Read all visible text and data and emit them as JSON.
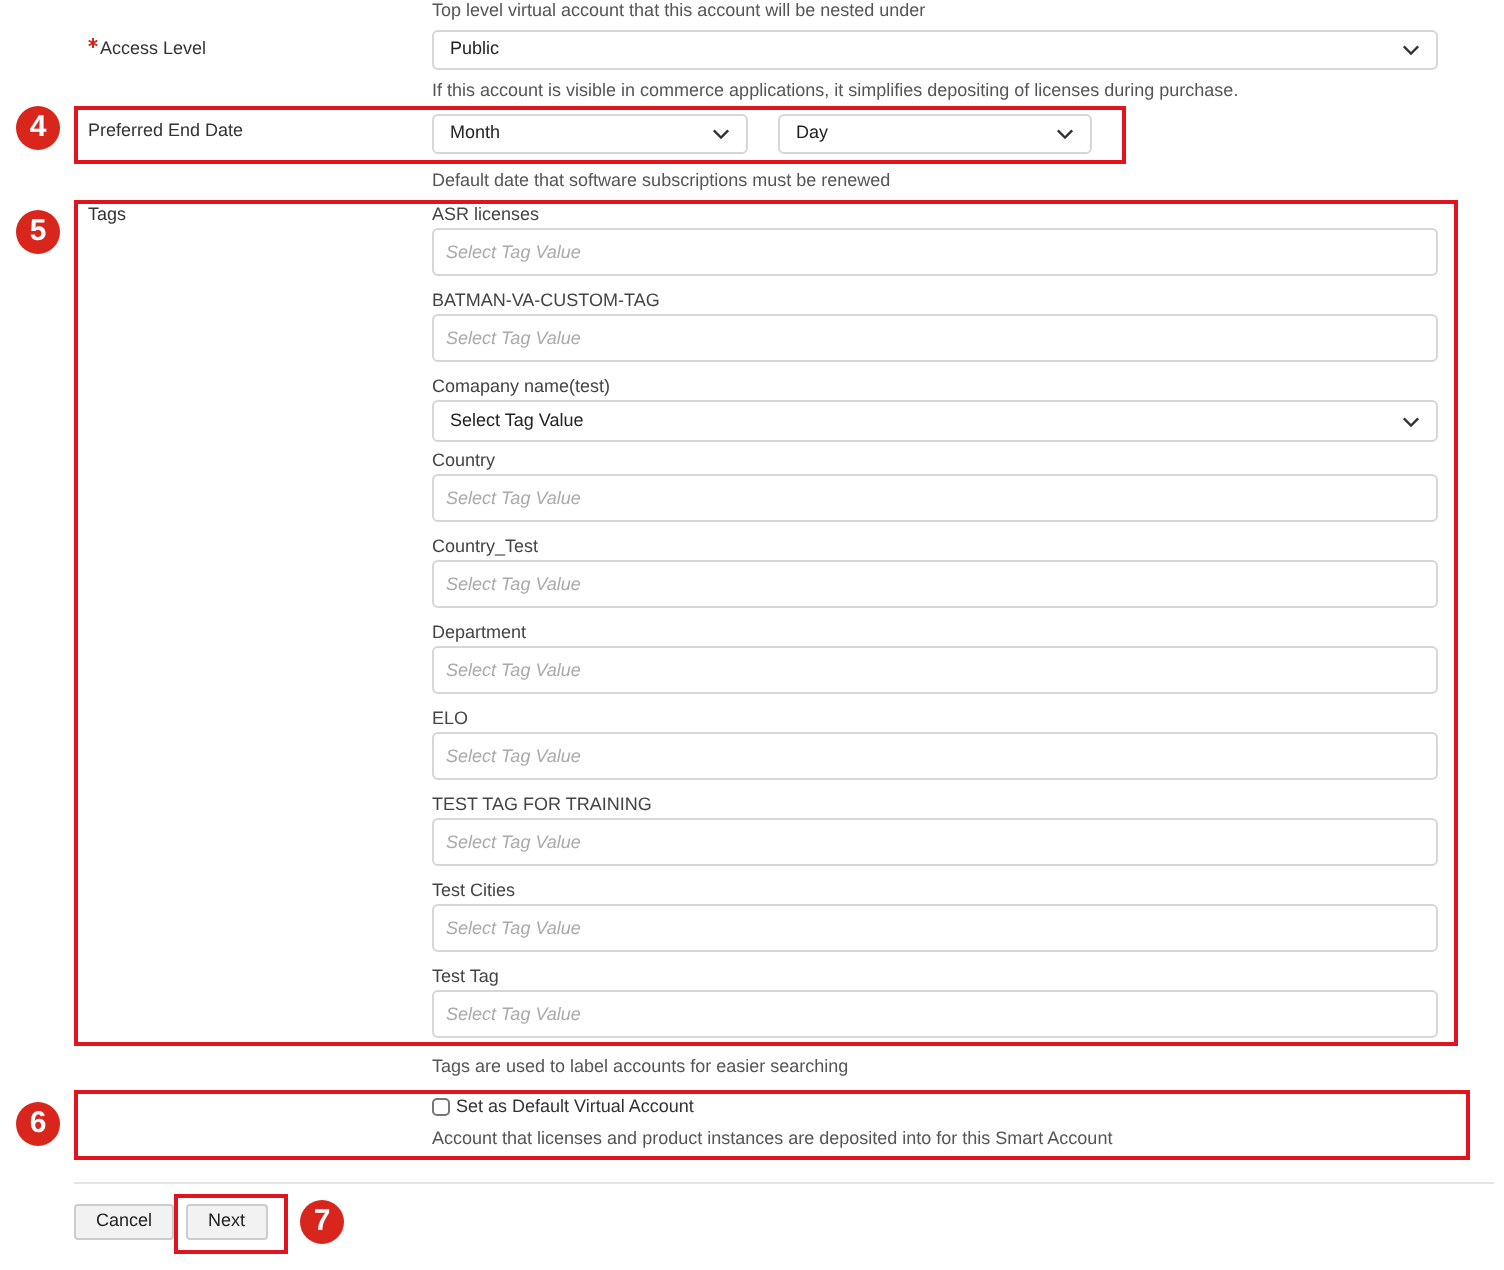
{
  "parent_help": "Top level virtual account that this account will be nested under",
  "access_level": {
    "label": "Access Level",
    "required": true,
    "value": "Public",
    "help": "If this account is visible in commerce applications, it simplifies depositing of licenses during purchase."
  },
  "preferred_end_date": {
    "label": "Preferred End Date",
    "month": "Month",
    "day": "Day",
    "help": "Default date that software subscriptions must be renewed",
    "callout": "4"
  },
  "tags": {
    "label": "Tags",
    "callout": "5",
    "items": [
      {
        "name": "ASR licenses",
        "kind": "text",
        "placeholder": "Select Tag Value"
      },
      {
        "name": "BATMAN-VA-CUSTOM-TAG",
        "kind": "text",
        "placeholder": "Select Tag Value"
      },
      {
        "name": "Comapany name(test)",
        "kind": "select",
        "value": "Select Tag Value"
      },
      {
        "name": "Country",
        "kind": "text",
        "placeholder": "Select Tag Value"
      },
      {
        "name": "Country_Test",
        "kind": "text",
        "placeholder": "Select Tag Value"
      },
      {
        "name": "Department",
        "kind": "text",
        "placeholder": "Select Tag Value"
      },
      {
        "name": "ELO",
        "kind": "text",
        "placeholder": "Select Tag Value"
      },
      {
        "name": "TEST TAG FOR TRAINING",
        "kind": "text",
        "placeholder": "Select Tag Value"
      },
      {
        "name": "Test Cities",
        "kind": "text",
        "placeholder": "Select Tag Value"
      },
      {
        "name": "Test Tag",
        "kind": "text",
        "placeholder": "Select Tag Value"
      }
    ],
    "help": "Tags are used to label accounts for easier searching"
  },
  "default_account": {
    "label": "Set as Default Virtual Account",
    "checked": false,
    "help": "Account that licenses and product instances are deposited into for this Smart Account",
    "callout": "6"
  },
  "buttons": [
    {
      "label": "Cancel"
    },
    {
      "label": "Next",
      "callout": "7"
    }
  ]
}
